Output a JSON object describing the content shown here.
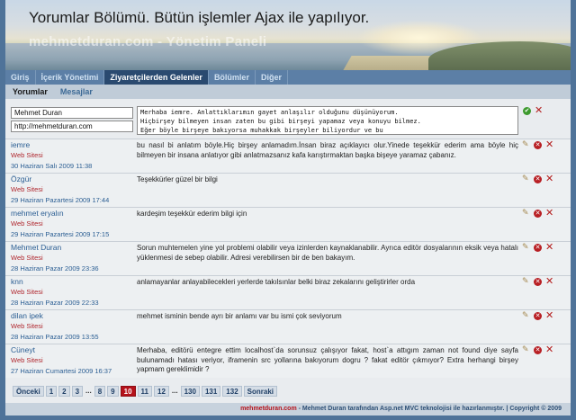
{
  "header": {
    "title": "Yorumlar Bölümü. Bütün işlemler Ajax ile yapılıyor.",
    "subtitle": "mehmetduran.com - Yönetim Paneli"
  },
  "nav": {
    "items": [
      "Giriş",
      "İçerik Yönetimi",
      "Ziyaretçilerden Gelenler",
      "Bölümler",
      "Diğer"
    ],
    "active": "Ziyaretçilerden Gelenler"
  },
  "subnav": {
    "items": [
      "Yorumlar",
      "Mesajlar"
    ],
    "active": "Yorumlar"
  },
  "form": {
    "name_value": "Mehmet Duran",
    "url_value": "http://mehmetduran.com",
    "comment_value": "Merhaba iemre. Anlattıklarımın gayet anlaşılır olduğunu düşünüyorum.\nHiçbirşey bilmeyen insan zaten bu gibi birşeyi yapamaz veya konuyu bilmez.\nEğer böyle birşeye bakıyorsa muhakkak birşeyler biliyordur ve bu"
  },
  "comments": [
    {
      "name": "iemre",
      "site": "Web Sitesi",
      "date": "30 Haziran Salı 2009 11:38",
      "message": "bu nasıl bi anlatım böyle.Hiç birşey anlamadım.İnsan biraz açıklayıcı olur.Yinede teşekkür ederim ama böyle hiç bilmeyen bir insana anlatıyor gibi anlatmazsanız kafa karıştırmaktan başka bişeye yaramaz çabanız."
    },
    {
      "name": "Özgür",
      "site": "Web Sitesi",
      "date": "29 Haziran Pazartesi 2009 17:44",
      "message": "Teşekkürler güzel bir bilgi"
    },
    {
      "name": "mehmet eryalın",
      "site": "Web Sitesi",
      "date": "29 Haziran Pazartesi 2009 17:15",
      "message": "kardeşim teşekkür ederim bilgi için"
    },
    {
      "name": "Mehmet Duran",
      "site": "Web Sitesi",
      "date": "28 Haziran Pazar 2009 23:36",
      "message": "Sorun muhtemelen yine yol problemi olabilir veya izinlerden kaynaklanabilir. Ayrıca editör dosyalarının eksik veya hatalı yüklenmesi de sebep olabilir. Adresi verebilirsen bir de ben bakayım."
    },
    {
      "name": "knn",
      "site": "Web Sitesi",
      "date": "28 Haziran Pazar 2009 22:33",
      "message": "anlamayanlar anlayabilecekleri yerlerde takılsınlar belki biraz zekalarını geliştirirler orda"
    },
    {
      "name": "dilan ipek",
      "site": "Web Sitesi",
      "date": "28 Haziran Pazar 2009 13:55",
      "message": "mehmet isminin bende ayrı bir anlamı var bu ismi çok seviyorum"
    },
    {
      "name": "Cüneyt",
      "site": "Web Sitesi",
      "date": "27 Haziran Cumartesi 2009 16:37",
      "message": "Merhaba, editörü entegre ettim localhost`da sorunsuz çalışıyor fakat, host`a attıgım zaman not found diye sayfa bulunamadı hatası veriyor, iframenin src yollarına bakıyorum dogru ? fakat editör çıkmıyor? Extra herhangi birşey yapmam gereklimidir ?"
    }
  ],
  "pager": {
    "prev": "Önceki",
    "next": "Sonraki",
    "pages": [
      "1",
      "2",
      "3",
      "...",
      "8",
      "9",
      "10",
      "11",
      "12",
      "...",
      "130",
      "131",
      "132"
    ],
    "current": "10"
  },
  "footer": {
    "brand": "mehmetduran.com",
    "text": " - Mehmet Duran tarafından Asp.net MVC teknolojisi ile hazırlanmıştır. | Copyright © 2009"
  }
}
